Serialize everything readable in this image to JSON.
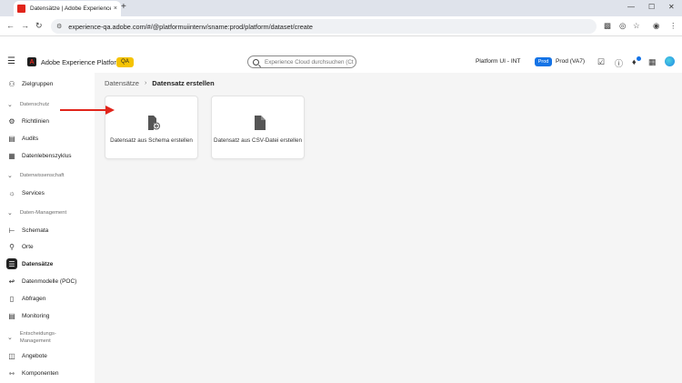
{
  "browser": {
    "tab_title": "Datensätze | Adobe Experience",
    "tab_close": "×",
    "new_tab": "+",
    "url": "experience-qa.adobe.com/#/@platformuiintenv/sname:prod/platform/dataset/create"
  },
  "header": {
    "app_name": "Adobe Experience Platform",
    "env_badge": "QA",
    "search_placeholder": "Experience Cloud durchsuchen (Ctr...",
    "sandbox_label": "Platform UI - INT",
    "prod_badge": "Prod",
    "prod_name": "Prod (VA7)"
  },
  "sidebar": {
    "items": [
      {
        "label": "Zielgruppen",
        "icon": "audience-icon"
      },
      {
        "section": "Datenschutz"
      },
      {
        "label": "Richtlinien",
        "icon": "policy-icon"
      },
      {
        "label": "Audits",
        "icon": "audit-icon"
      },
      {
        "label": "Datenlebenszyklus",
        "icon": "lifecycle-icon"
      },
      {
        "section": "Datenwissenschaft"
      },
      {
        "label": "Services",
        "icon": "services-icon"
      },
      {
        "section": "Daten-Management"
      },
      {
        "label": "Schemata",
        "icon": "schema-icon"
      },
      {
        "label": "Orte",
        "icon": "location-icon"
      },
      {
        "label": "Datensätze",
        "icon": "dataset-icon",
        "active": true
      },
      {
        "label": "Datenmodelle (POC)",
        "icon": "datamodel-icon"
      },
      {
        "label": "Abfragen",
        "icon": "query-icon"
      },
      {
        "label": "Monitoring",
        "icon": "monitoring-icon"
      },
      {
        "section": "Entscheidungs-Management"
      },
      {
        "label": "Angebote",
        "icon": "offers-icon"
      },
      {
        "label": "Komponenten",
        "icon": "components-icon"
      }
    ]
  },
  "breadcrumb": {
    "parent": "Datensätze",
    "current": "Datensatz erstellen"
  },
  "cards": [
    {
      "label": "Datensatz aus Schema erstellen",
      "icon": "schema-add-icon"
    },
    {
      "label": "Datensatz aus CSV-Datei erstellen",
      "icon": "file-icon"
    }
  ],
  "colors": {
    "accent": "#1473e6",
    "qa": "#f5c300",
    "arrow": "#e1251b"
  }
}
